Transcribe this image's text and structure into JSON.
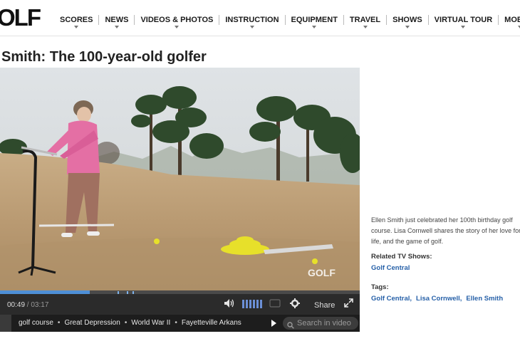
{
  "header": {
    "logo": "OLF",
    "nav": [
      "SCORES",
      "NEWS",
      "VIDEOS & PHOTOS",
      "INSTRUCTION",
      "EQUIPMENT",
      "TRAVEL",
      "SHOWS",
      "VIRTUAL TOUR",
      "MOBILE"
    ]
  },
  "page": {
    "title": "Smith: The 100-year-old golfer"
  },
  "video": {
    "watermark": "GOLF",
    "current_time": "00:49",
    "separator": " / ",
    "total_time": "03:17",
    "progress_fraction": 0.249,
    "share_label": "Share"
  },
  "tag_strip": {
    "tags": [
      "golf course",
      "Great Depression",
      "World War II",
      "Fayetteville Arkans"
    ],
    "search_placeholder": "Search in video"
  },
  "sidebar": {
    "description": "Ellen Smith just celebrated her 100th birthday golf course. Lisa Cornwell shares the story of her love for life, and the game of golf.",
    "related_heading": "Related TV Shows:",
    "related_show": "Golf Central",
    "tags_heading": "Tags:",
    "tags": [
      "Golf Central,",
      "Lisa Cornwell,",
      "Ellen Smith"
    ]
  },
  "colors": {
    "link": "#2660a8",
    "progress": "#4e8fd6",
    "control_bar": "#2b2b2b"
  }
}
